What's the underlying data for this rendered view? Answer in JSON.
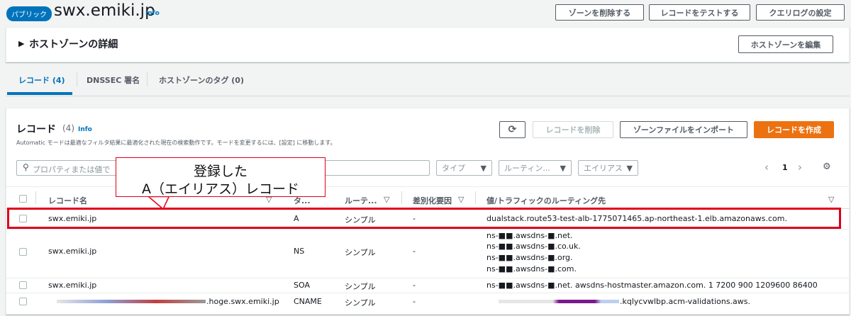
{
  "header": {
    "badge": "パブリック",
    "title": "swx.emiki.jp",
    "info": "Info",
    "buttons": {
      "delete_zone": "ゾーンを削除する",
      "test_record": "レコードをテストする",
      "query_log": "クエリログの設定"
    }
  },
  "details": {
    "title": "ホストゾーンの詳細",
    "edit": "ホストゾーンを編集"
  },
  "tabs": [
    "レコード (4)",
    "DNSSEC 署名",
    "ホストゾーンのタグ (0)"
  ],
  "records_panel": {
    "title": "レコード",
    "count": "(4)",
    "info": "Info",
    "description": "Automatic モードは最適なフィルタ結果に最適化された現在の検索動作です。モードを変更するには、[設定] に移動します。",
    "refresh": "⟳",
    "delete": "レコードを削除",
    "import": "ゾーンファイルをインポート",
    "create": "レコードを作成",
    "search_placeholder": "プロパティまたは値で",
    "filters": {
      "type": "タイプ",
      "routing": "ルーティン...",
      "alias": "エイリアス"
    },
    "page": "1"
  },
  "columns": {
    "name": "レコード名",
    "type": "タ...",
    "routing": "ルーテ...",
    "differentiator": "差別化要因",
    "value": "値/トラフィックのルーティング先"
  },
  "rows": [
    {
      "name": "swx.emiki.jp",
      "type": "A",
      "routing": "シンプル",
      "diff": "-",
      "value": "dualstack.route53-test-alb-1775071465.ap-northeast-1.elb.amazonaws.com."
    },
    {
      "name": "swx.emiki.jp",
      "type": "NS",
      "routing": "シンプル",
      "diff": "-",
      "values": [
        "ns-■■.awsdns-■.net.",
        "ns-■■.awsdns-■.co.uk.",
        "ns-■■.awsdns-■.org.",
        "ns-■■.awsdns-■.com."
      ]
    },
    {
      "name": "swx.emiki.jp",
      "type": "SOA",
      "routing": "シンプル",
      "diff": "-",
      "value": "ns-■■.awsdns-■.net. awsdns-hostmaster.amazon.com. 1 7200 900 1209600 86400"
    },
    {
      "name": ".hoge.swx.emiki.jp",
      "type": "CNAME",
      "routing": "シンプル",
      "diff": "-",
      "value": ".kqlycvwlbp.acm-validations.aws."
    }
  ],
  "annotation": {
    "line1": "登録した",
    "line2": "A（エイリアス）レコード"
  },
  "colors": {
    "accent": "#0073bb",
    "primary": "#ec7211",
    "highlight": "#e0001a"
  }
}
